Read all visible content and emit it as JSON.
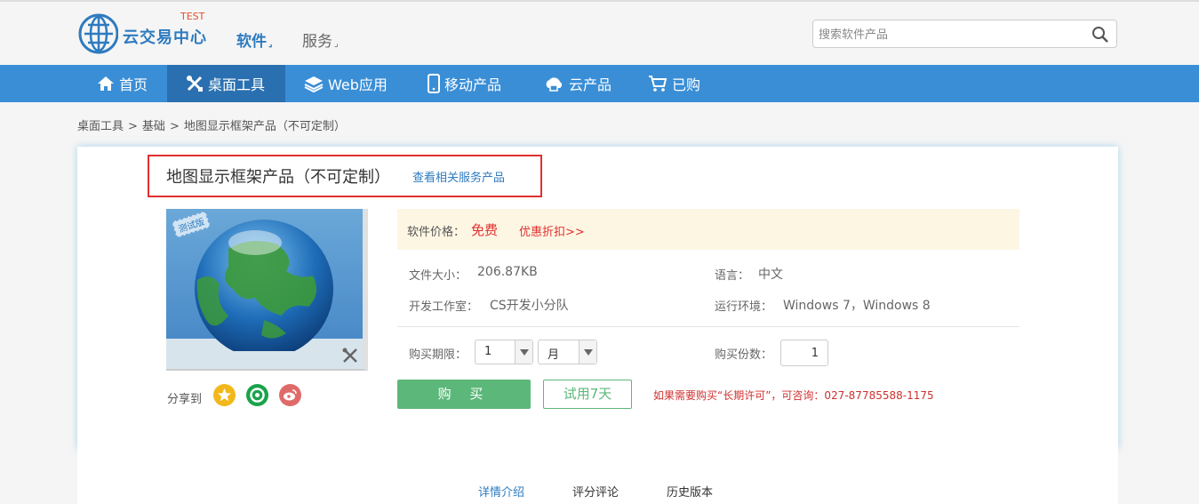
{
  "header": {
    "logo_text": "云交易中心",
    "logo_badge": "TEST",
    "nav_software": "软件",
    "nav_service": "服务",
    "search_placeholder": "搜索软件产品"
  },
  "mainnav": {
    "items": [
      {
        "label": "首页",
        "icon": "home-icon"
      },
      {
        "label": "桌面工具",
        "icon": "tools-icon",
        "active": true
      },
      {
        "label": "Web应用",
        "icon": "layers-icon"
      },
      {
        "label": "移动产品",
        "icon": "mobile-icon"
      },
      {
        "label": "云产品",
        "icon": "cloud-icon"
      },
      {
        "label": "已购",
        "icon": "cart-icon"
      }
    ],
    "active_color": "#2a70b0",
    "bar_color": "#3a8ed6"
  },
  "breadcrumb": {
    "items": [
      "桌面工具",
      "基础",
      "地图显示框架产品（不可定制）"
    ],
    "separator": ">"
  },
  "product": {
    "title": "地图显示框架产品（不可定制）",
    "related_link": "查看相关服务产品",
    "badge": "测试版",
    "share_label": "分享到",
    "price_label": "软件价格：",
    "price_value": "免费",
    "discount_link": "优惠折扣>>",
    "file_size_label": "文件大小：",
    "file_size_value": "206.87KB",
    "language_label": "语言：",
    "language_value": "中文",
    "studio_label": "开发工作室：",
    "studio_value": "CS开发小分队",
    "env_label": "运行环境：",
    "env_value": "Windows 7，Windows 8",
    "period_label": "购买期限：",
    "period_value": "1",
    "period_unit": "月",
    "copies_label": "购买份数：",
    "copies_value": "1",
    "buy_button": "购 买",
    "trial_button": "试用7天",
    "notice": "如果需要购买“长期许可”，可咨询：027-87785588-1175"
  },
  "tabs": [
    "详情介绍",
    "评分评论",
    "历史版本"
  ],
  "colors": {
    "accent": "#2e7bbf",
    "price_red": "#e03030",
    "buy_green": "#5cb87a"
  }
}
